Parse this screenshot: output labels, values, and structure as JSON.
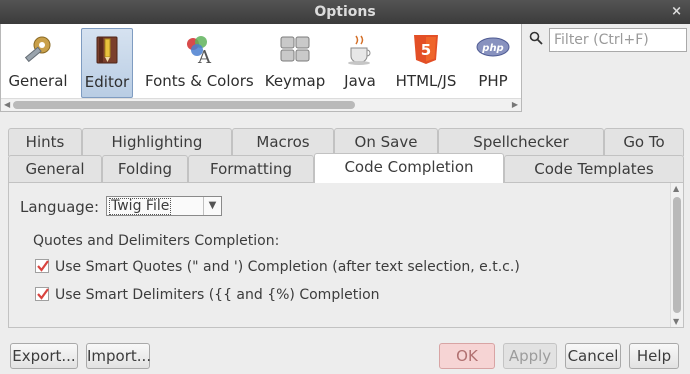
{
  "window": {
    "title": "Options",
    "close_glyph": "×"
  },
  "categories": [
    {
      "label": "General",
      "icon": "wrench-gear-icon"
    },
    {
      "label": "Editor",
      "icon": "pencil-book-icon",
      "selected": true
    },
    {
      "label": "Fonts & Colors",
      "icon": "palette-font-icon"
    },
    {
      "label": "Keymap",
      "icon": "keyboard-icon"
    },
    {
      "label": "Java",
      "icon": "java-cup-icon"
    },
    {
      "label": "HTML/JS",
      "icon": "html5-shield-icon"
    },
    {
      "label": "PHP",
      "icon": "php-logo-icon"
    }
  ],
  "search": {
    "placeholder": "Filter (Ctrl+F)"
  },
  "tabs_row1": [
    "Hints",
    "Highlighting",
    "Macros",
    "On Save",
    "Spellchecker",
    "Go To"
  ],
  "tabs_row2": [
    "General",
    "Folding",
    "Formatting",
    "Code Completion",
    "Code Templates"
  ],
  "selected_tab": "Code Completion",
  "panel": {
    "language_label": "Language:",
    "language_value": "Twig File",
    "section_label": "Quotes and Delimiters Completion:",
    "checkboxes": [
      {
        "label": "Use Smart Quotes (\" and ') Completion (after text selection, e.t.c.)",
        "checked": true
      },
      {
        "label": "Use Smart Delimiters ({{ and {%) Completion",
        "checked": true
      }
    ]
  },
  "buttons": {
    "export": "Export...",
    "import": "Import...",
    "ok": "OK",
    "apply": "Apply",
    "cancel": "Cancel",
    "help": "Help"
  },
  "colors": {
    "checkmark": "#d9443f",
    "selection": "#b9cde4",
    "ok_button": "#f6d4d4"
  }
}
